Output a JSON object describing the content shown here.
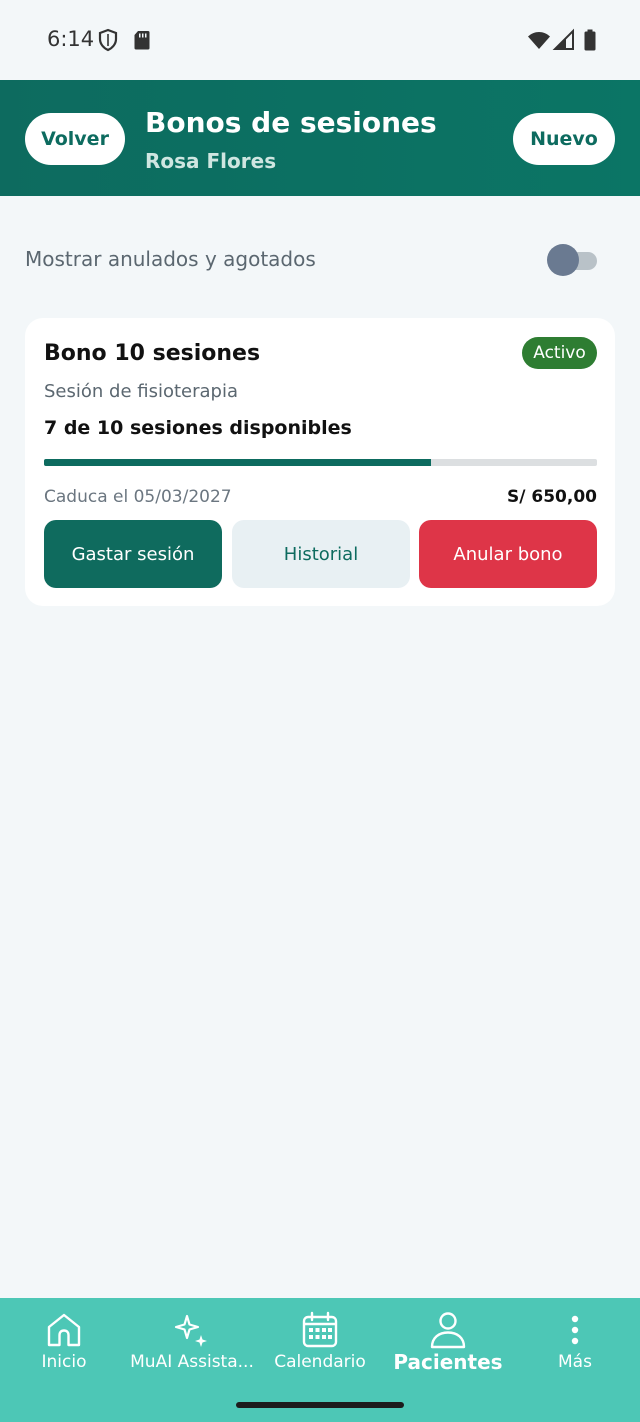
{
  "status_bar": {
    "time": "6:14"
  },
  "header": {
    "back_label": "Volver",
    "title": "Bonos de sesiones",
    "subtitle": "Rosa Flores",
    "new_label": "Nuevo"
  },
  "filter": {
    "label": "Mostrar anulados y agotados",
    "enabled": false
  },
  "bono": {
    "title": "Bono 10 sesiones",
    "status": "Activo",
    "service": "Sesión de fisioterapia",
    "availability": "7 de 10 sesiones disponibles",
    "sessions_available": 7,
    "sessions_total": 10,
    "expiry": "Caduca el 05/03/2027",
    "price": "S/ 650,00",
    "actions": {
      "spend": "Gastar sesión",
      "history": "Historial",
      "void": "Anular bono"
    }
  },
  "bottom_nav": {
    "items": [
      {
        "label": "Inicio",
        "icon": "home-icon"
      },
      {
        "label": "MuAI Assista...",
        "icon": "sparkles-icon"
      },
      {
        "label": "Calendario",
        "icon": "calendar-icon"
      },
      {
        "label": "Pacientes",
        "icon": "person-icon",
        "active": true
      },
      {
        "label": "Más",
        "icon": "more-vertical-icon"
      }
    ]
  },
  "colors": {
    "brand": "#0d6b5f",
    "nav_background": "#4dc7b6",
    "badge_active": "#2e7d32",
    "danger": "#de3548"
  }
}
